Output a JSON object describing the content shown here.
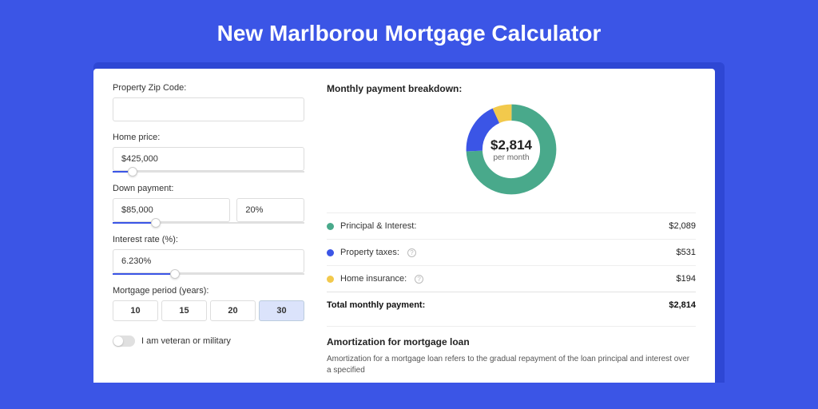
{
  "title": "New Marlborou Mortgage Calculator",
  "form": {
    "zip_label": "Property Zip Code:",
    "zip_value": "",
    "price_label": "Home price:",
    "price_value": "$425,000",
    "down_label": "Down payment:",
    "down_value": "$85,000",
    "down_pct": "20%",
    "rate_label": "Interest rate (%):",
    "rate_value": "6.230%",
    "period_label": "Mortgage period (years):",
    "periods": [
      "10",
      "15",
      "20",
      "30"
    ],
    "veteran_label": "I am veteran or military"
  },
  "breakdown": {
    "heading": "Monthly payment breakdown:",
    "center_amount": "$2,814",
    "center_sub": "per month",
    "items": [
      {
        "label": "Principal & Interest:",
        "value": "$2,089"
      },
      {
        "label": "Property taxes:",
        "value": "$531"
      },
      {
        "label": "Home insurance:",
        "value": "$194"
      }
    ],
    "total_label": "Total monthly payment:",
    "total_value": "$2,814"
  },
  "amort": {
    "heading": "Amortization for mortgage loan",
    "text": "Amortization for a mortgage loan refers to the gradual repayment of the loan principal and interest over a specified"
  },
  "chart_data": {
    "type": "pie",
    "title": "Monthly payment breakdown",
    "series": [
      {
        "name": "Principal & Interest",
        "value": 2089,
        "color": "#49A98B"
      },
      {
        "name": "Property taxes",
        "value": 531,
        "color": "#3B55E6"
      },
      {
        "name": "Home insurance",
        "value": 194,
        "color": "#F2C94C"
      }
    ],
    "total": 2814,
    "unit": "USD per month"
  }
}
